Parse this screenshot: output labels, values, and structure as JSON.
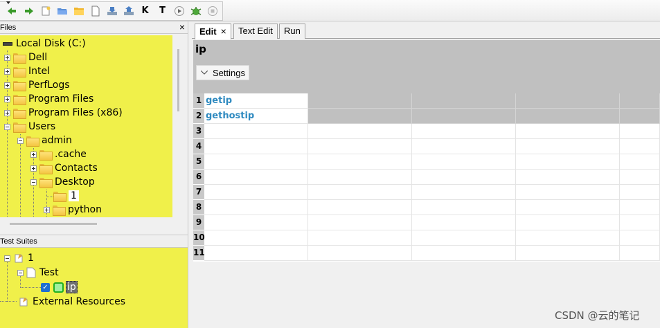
{
  "toolbar": {
    "icons": [
      "back-arrow-icon",
      "forward-arrow-icon",
      "new-project-icon",
      "open-folder-icon",
      "open-directory-icon",
      "new-file-icon",
      "import-icon",
      "export-icon",
      "keyword-search-icon",
      "text-search-icon",
      "run-icon",
      "debug-icon",
      "stop-icon"
    ],
    "k_glyph": "K",
    "t_glyph": "T"
  },
  "files_pane": {
    "title": "Files",
    "close": "×",
    "tree": [
      {
        "label": "Local Disk (C:)",
        "kind": "drive"
      },
      {
        "label": "Dell",
        "kind": "folder"
      },
      {
        "label": "Intel",
        "kind": "folder"
      },
      {
        "label": "PerfLogs",
        "kind": "folder"
      },
      {
        "label": "Program Files",
        "kind": "folder"
      },
      {
        "label": "Program Files (x86)",
        "kind": "folder"
      },
      {
        "label": "Users",
        "kind": "folder"
      },
      {
        "label": "admin",
        "kind": "folder"
      },
      {
        "label": ".cache",
        "kind": "folder"
      },
      {
        "label": "Contacts",
        "kind": "folder"
      },
      {
        "label": "Desktop",
        "kind": "folder"
      },
      {
        "label": "1",
        "kind": "folder"
      },
      {
        "label": "python",
        "kind": "folder"
      }
    ]
  },
  "suites_pane": {
    "title": "Test Suites",
    "tree": [
      {
        "label": "1"
      },
      {
        "label": "Test"
      },
      {
        "label": "ip"
      },
      {
        "label": "External Resources"
      }
    ]
  },
  "tabs": [
    {
      "label": "Edit",
      "close": "×"
    },
    {
      "label": "Text Edit"
    },
    {
      "label": "Run"
    }
  ],
  "editor": {
    "title": "ip",
    "settings_label": "Settings",
    "rows": [
      "1",
      "2",
      "3",
      "4",
      "5",
      "6",
      "7",
      "8",
      "9",
      "10",
      "11"
    ],
    "keywords": [
      "getip",
      "gethostip"
    ]
  },
  "watermark": "CSDN @云的笔记",
  "colors": {
    "tree_bg": "#f0f04a",
    "keyword": "#2f8ac0",
    "grid_shade": "#c0c0c0"
  }
}
